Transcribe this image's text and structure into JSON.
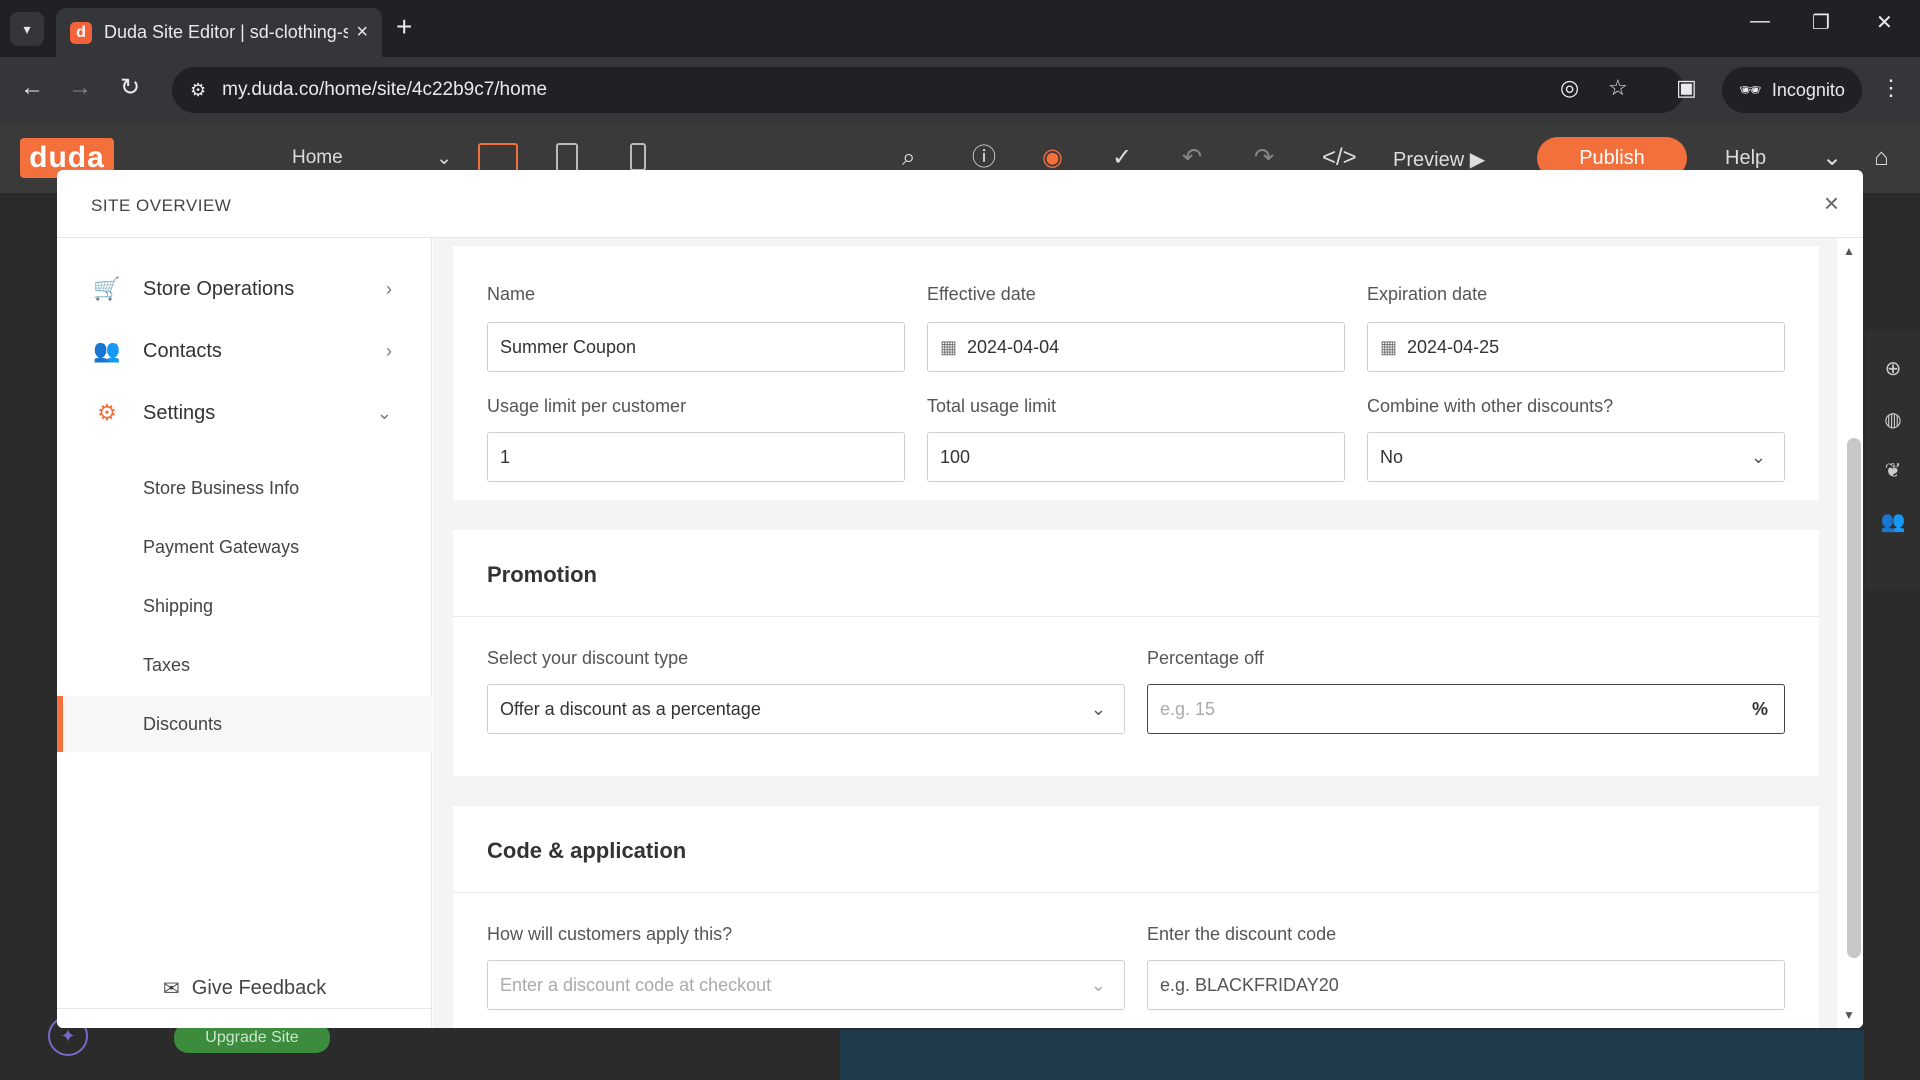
{
  "browser": {
    "tab_title": "Duda Site Editor | sd-clothing-s",
    "tab_favicon": "d",
    "url": "my.duda.co/home/site/4c22b9c7/home",
    "incognito_label": "Incognito"
  },
  "editor": {
    "logo": "duda",
    "page_selector": "Home",
    "preview_label": "Preview",
    "publish_label": "Publish",
    "help_label": "Help",
    "upgrade_label": "Upgrade Site"
  },
  "modal": {
    "title": "SITE OVERVIEW",
    "sidebar": {
      "items": [
        {
          "label": "Store Operations",
          "icon": "cart-icon"
        },
        {
          "label": "Contacts",
          "icon": "users-icon"
        },
        {
          "label": "Settings",
          "icon": "gear-icon"
        }
      ],
      "sub_items": [
        {
          "label": "Store Business Info"
        },
        {
          "label": "Payment Gateways"
        },
        {
          "label": "Shipping"
        },
        {
          "label": "Taxes"
        },
        {
          "label": "Discounts"
        }
      ],
      "feedback_label": "Give Feedback"
    },
    "details": {
      "name_label": "Name",
      "name_value": "Summer Coupon",
      "effective_label": "Effective date",
      "effective_value": "2024-04-04",
      "expiration_label": "Expiration date",
      "expiration_value": "2024-04-25",
      "usage_customer_label": "Usage limit per customer",
      "usage_customer_value": "1",
      "total_usage_label": "Total usage limit",
      "total_usage_value": "100",
      "combine_label": "Combine with other discounts?",
      "combine_value": "No"
    },
    "promotion": {
      "title": "Promotion",
      "type_label": "Select your discount type",
      "type_value": "Offer a discount as a percentage",
      "percentage_label": "Percentage off",
      "percentage_placeholder": "e.g. 15",
      "percentage_unit": "%"
    },
    "code": {
      "title": "Code & application",
      "apply_label": "How will customers apply this?",
      "apply_value": "Enter a discount code at checkout",
      "code_label": "Enter the discount code",
      "code_placeholder": "e.g. BLACKFRIDAY20"
    }
  },
  "colors": {
    "accent": "#f36f3c",
    "browser_dark": "#202124"
  }
}
